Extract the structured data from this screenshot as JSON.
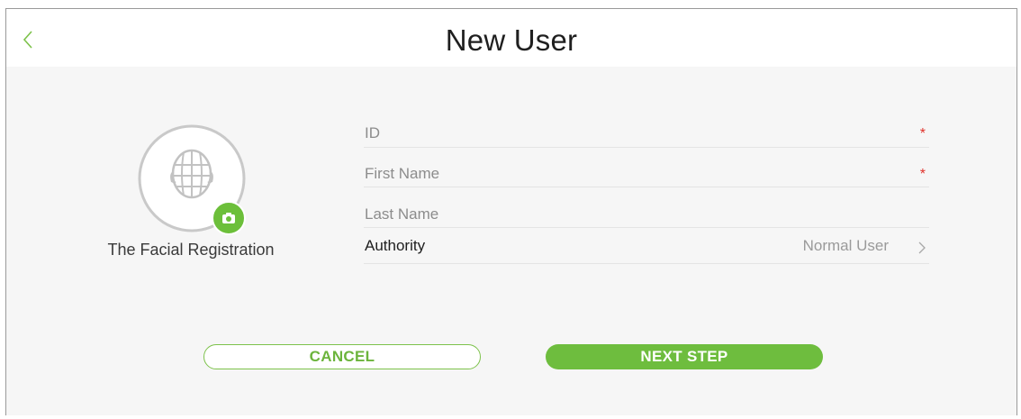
{
  "header": {
    "title": "New User"
  },
  "face": {
    "label": "The Facial Registration"
  },
  "form": {
    "fields": [
      {
        "label": "ID",
        "required_mark": "*"
      },
      {
        "label": "First Name",
        "required_mark": "*"
      },
      {
        "label": "Last Name"
      }
    ],
    "authority": {
      "label": "Authority",
      "value": "Normal User"
    }
  },
  "buttons": {
    "cancel": "CANCEL",
    "next": "NEXT STEP"
  },
  "colors": {
    "accent": "#6ebd3e",
    "required": "#e0312a"
  }
}
